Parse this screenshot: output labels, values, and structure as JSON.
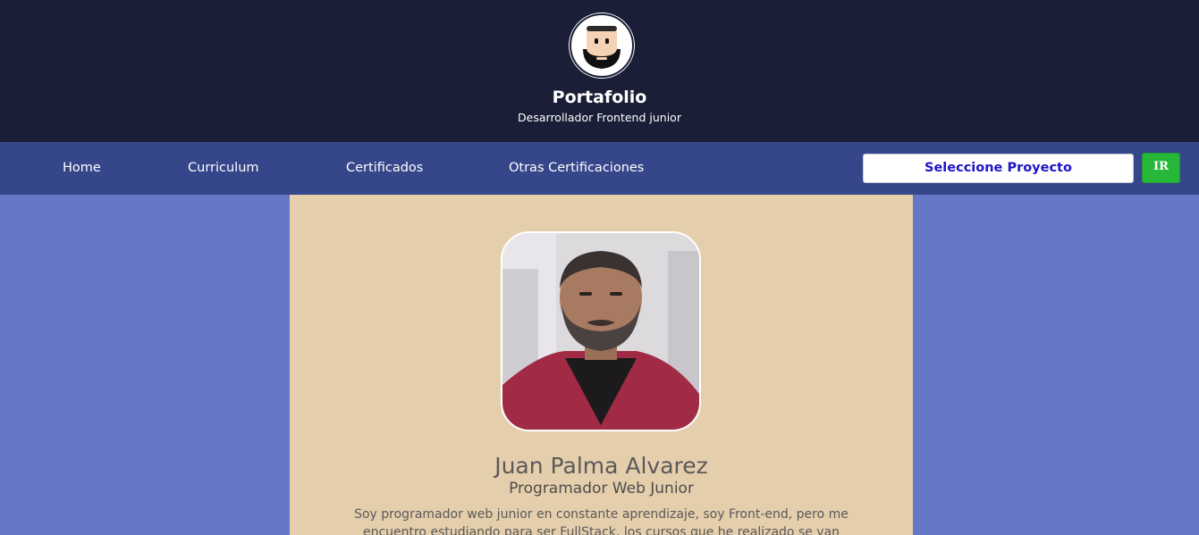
{
  "header": {
    "title": "Portafolio",
    "subtitle": "Desarrollador Frontend junior",
    "logo_icon": "bearded-face-avatar-icon"
  },
  "nav": {
    "items": [
      {
        "label": "Home"
      },
      {
        "label": "Curriculum"
      },
      {
        "label": "Certificados"
      },
      {
        "label": "Otras Certificaciones"
      }
    ],
    "project_select": {
      "selected": "Seleccione Proyecto"
    },
    "go_button": {
      "label": "IR"
    }
  },
  "profile": {
    "name": "Juan Palma Alvarez",
    "role": "Programador Web Junior",
    "bio": "Soy programador web junior en constante aprendizaje, soy Front-end, pero me encuentro estudiando para ser FullStack, los cursos que he realizado se van"
  },
  "colors": {
    "header_bg": "#1a1e36",
    "nav_bg": "#36468a",
    "page_bg": "#6677c6",
    "content_bg": "#e5ceab",
    "select_text": "#1d14c8",
    "go_button_bg": "#27b83a"
  }
}
